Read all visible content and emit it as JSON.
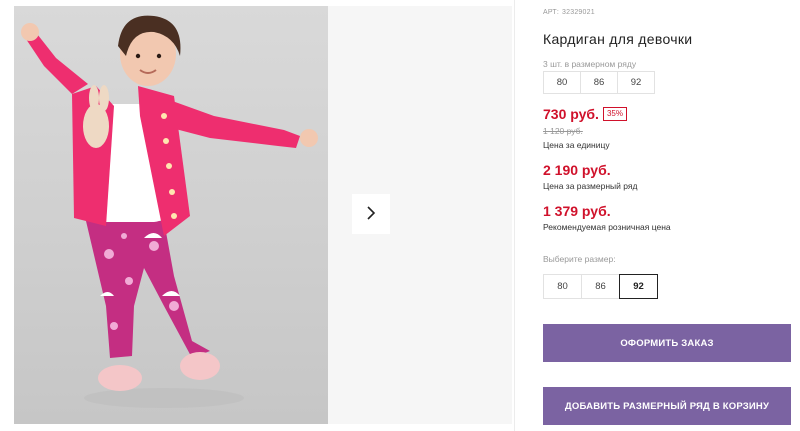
{
  "product": {
    "sku_label": "АРТ:",
    "sku": "32329021",
    "title": "Кардиган для девочки",
    "row_caption": "3 шт. в размерном ряду",
    "row_sizes": [
      "80",
      "86",
      "92"
    ]
  },
  "pricing": {
    "unit_price": "730 руб.",
    "discount": "35%",
    "old_price": "1 120 руб.",
    "unit_caption": "Цена за единицу",
    "row_price": "2 190 руб.",
    "row_caption": "Цена за размерный ряд",
    "retail_price": "1 379 руб.",
    "retail_caption": "Рекомендуемая розничная цена"
  },
  "size_picker": {
    "label": "Выберите размер:",
    "sizes": [
      "80",
      "86",
      "92"
    ],
    "selected": "92"
  },
  "actions": {
    "order": "ОФОРМИТЬ ЗАКАЗ",
    "add_row": "ДОБАВИТЬ РАЗМЕРНЫЙ РЯД В КОРЗИНУ"
  },
  "gallery": {
    "next_icon": "chevron-right-icon"
  },
  "colors": {
    "accent": "#7b63a2",
    "price": "#d0112b",
    "cardigan": "#ee2e6f",
    "leggings": "#c42e82"
  }
}
